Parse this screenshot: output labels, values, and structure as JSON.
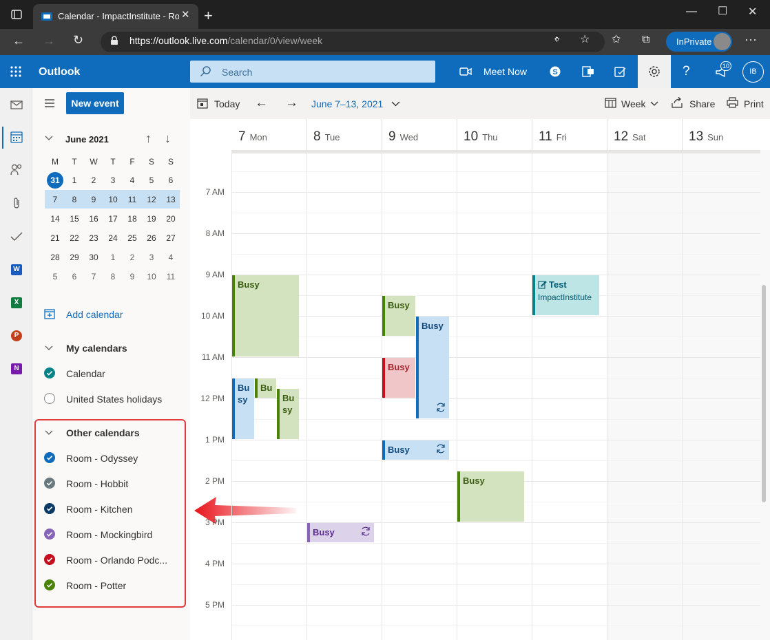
{
  "browser": {
    "tab_title": "Calendar - ImpactInstitute - Roo",
    "url_host": "https://outlook.live.com",
    "url_path": "/calendar/0/view/week",
    "inprivate_label": "InPrivate"
  },
  "header": {
    "app_name": "Outlook",
    "search_placeholder": "Search",
    "meet_now_label": "Meet Now",
    "notification_count": "10",
    "user_initials": "IB"
  },
  "sidebar": {
    "new_event_label": "New event",
    "mini_calendar": {
      "month_title": "June 2021",
      "weekdays": [
        "M",
        "T",
        "W",
        "T",
        "F",
        "S",
        "S"
      ],
      "weeks": [
        [
          "31",
          "1",
          "2",
          "3",
          "4",
          "5",
          "6"
        ],
        [
          "7",
          "8",
          "9",
          "10",
          "11",
          "12",
          "13"
        ],
        [
          "14",
          "15",
          "16",
          "17",
          "18",
          "19",
          "20"
        ],
        [
          "21",
          "22",
          "23",
          "24",
          "25",
          "26",
          "27"
        ],
        [
          "28",
          "29",
          "30",
          "1",
          "2",
          "3",
          "4"
        ],
        [
          "5",
          "6",
          "7",
          "8",
          "9",
          "10",
          "11"
        ]
      ]
    },
    "add_calendar_label": "Add calendar",
    "my_calendars": {
      "title": "My calendars",
      "items": [
        {
          "label": "Calendar",
          "color": "#038387",
          "checked": true
        },
        {
          "label": "United States holidays",
          "color": "#8a8886",
          "checked": false
        }
      ]
    },
    "other_calendars": {
      "title": "Other calendars",
      "items": [
        {
          "label": "Room - Odyssey",
          "color": "#0f6cbd",
          "checked": true
        },
        {
          "label": "Room - Hobbit",
          "color": "#69797e",
          "checked": true
        },
        {
          "label": "Room - Kitchen",
          "color": "#0b3a64",
          "checked": true
        },
        {
          "label": "Room - Mockingbird",
          "color": "#8764b8",
          "checked": true
        },
        {
          "label": "Room - Orlando Podc...",
          "color": "#c50f1f",
          "checked": true
        },
        {
          "label": "Room - Potter",
          "color": "#498205",
          "checked": true
        }
      ]
    }
  },
  "toolbar": {
    "today_label": "Today",
    "range_label": "June 7–13, 2021",
    "view_label": "Week",
    "share_label": "Share",
    "print_label": "Print"
  },
  "week": {
    "days": [
      {
        "num": "7",
        "name": "Mon"
      },
      {
        "num": "8",
        "name": "Tue"
      },
      {
        "num": "9",
        "name": "Wed"
      },
      {
        "num": "10",
        "name": "Thu"
      },
      {
        "num": "11",
        "name": "Fri"
      },
      {
        "num": "12",
        "name": "Sat"
      },
      {
        "num": "13",
        "name": "Sun"
      }
    ],
    "hours": [
      "7 AM",
      "8 AM",
      "9 AM",
      "10 AM",
      "11 AM",
      "12 PM",
      "1 PM",
      "2 PM",
      "3 PM",
      "4 PM",
      "5 PM"
    ]
  },
  "events": [
    {
      "title": "Busy"
    },
    {
      "title": "Bu sy"
    },
    {
      "title": "Bu"
    },
    {
      "title": "Bu sy"
    },
    {
      "title": "Busy"
    },
    {
      "title": "Busy"
    },
    {
      "title": "Busy"
    },
    {
      "title": "Busy"
    },
    {
      "title": "Busy"
    },
    {
      "title": "Busy"
    },
    {
      "title": "Test",
      "subtitle": "ImpactInstitute"
    }
  ]
}
